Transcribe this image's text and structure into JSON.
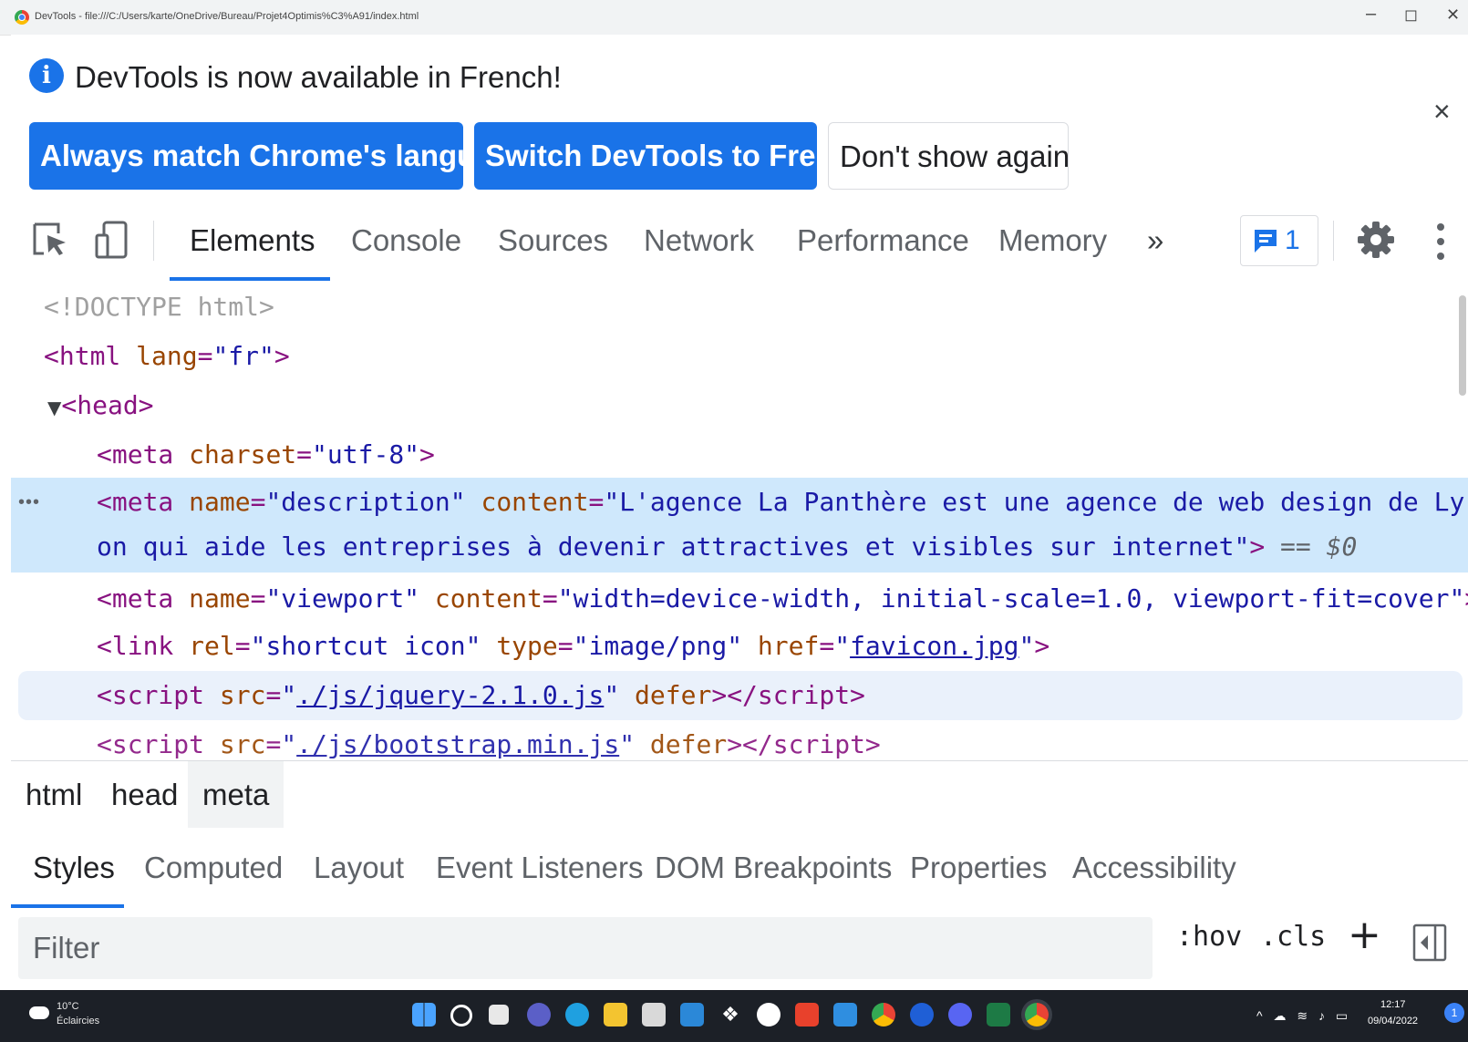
{
  "window": {
    "title": "DevTools - file:///C:/Users/karte/OneDrive/Bureau/Projet4Optimis%C3%A91/index.html",
    "minimize": "–",
    "maximize": "◻",
    "close": "✕"
  },
  "infobar": {
    "message": "DevTools is now available in French!",
    "buttons": {
      "always_match": "Always match Chrome's language",
      "switch_french": "Switch DevTools to French",
      "dont_show": "Don't show again"
    },
    "close": "×"
  },
  "toolbar": {
    "tabs": [
      "Elements",
      "Console",
      "Sources",
      "Network",
      "Performance",
      "Memory"
    ],
    "active_tab": "Elements",
    "more_tabs": "»",
    "issues_count": "1"
  },
  "dom": {
    "doctype": "<!DOCTYPE html>",
    "html_open": "<html",
    "html_attr": "lang",
    "html_val": "\"fr\"",
    "head": "<head>",
    "meta_charset_attr": "charset",
    "meta_charset_val": "\"utf-8\"",
    "meta_desc_name_val": "\"description\"",
    "meta_desc_content_1": "\"L'agence La Panthère est une agence  de web design de Ly",
    "meta_desc_content_2": "on qui aide les entreprises à devenir attractives et visibles sur internet\"",
    "selected_marker": "== $0",
    "meta_viewport_name_val": "\"viewport\"",
    "meta_viewport_content_val": "\"width=device-width, initial-scale=1.0, viewport-fit=cover\"",
    "link_rel_val": "\"shortcut icon\"",
    "link_type_val": "\"image/png\"",
    "link_href": "favicon.jpg",
    "script_src": "./js/jquery-2.1.0.js",
    "script_defer": "defer",
    "dots": "•••"
  },
  "breadcrumbs": [
    "html",
    "head",
    "meta"
  ],
  "styles_pane": {
    "tabs": [
      "Styles",
      "Computed",
      "Layout",
      "Event Listeners",
      "DOM Breakpoints",
      "Properties",
      "Accessibility"
    ],
    "active_tab": "Styles",
    "filter_placeholder": "Filter",
    "hov": ":hov",
    "cls": ".cls",
    "new_rule": "+"
  },
  "taskbar": {
    "weather_temp": "10°C",
    "weather_desc": "Éclaircies",
    "time": "12:17",
    "date": "09/04/2022",
    "notifications": "1"
  },
  "colors": {
    "accent": "#1a73e8",
    "selected_row": "#cfe8fc",
    "tag": "#881280",
    "attribute": "#994500",
    "value": "#1a1aa6"
  }
}
